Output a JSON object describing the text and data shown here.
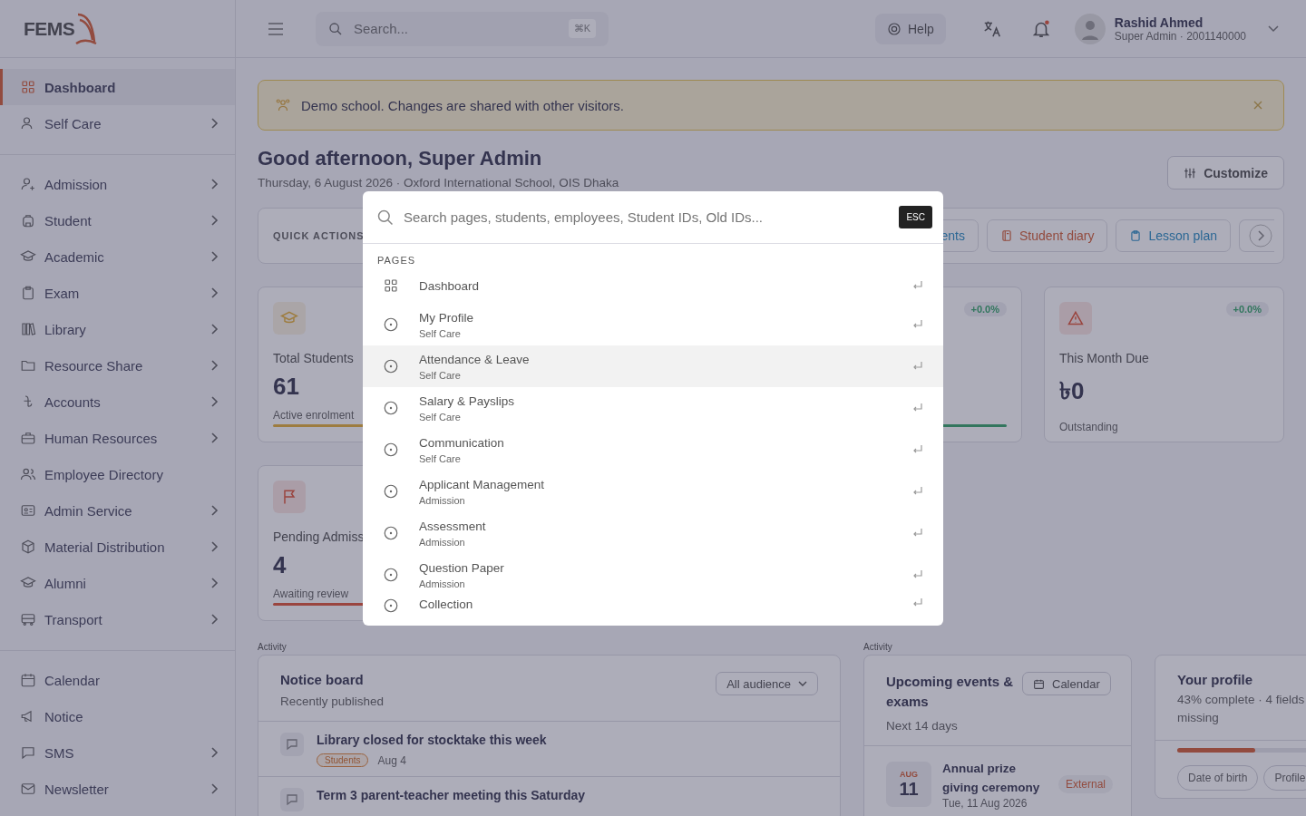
{
  "brand": {
    "name": "FEMS"
  },
  "sidebar": {
    "groups": [
      {
        "items": [
          {
            "label": "Dashboard",
            "selected": true,
            "submenu": false
          },
          {
            "label": "Self Care",
            "selected": false,
            "submenu": true
          }
        ]
      },
      {
        "items": [
          {
            "label": "Admission",
            "selected": false,
            "submenu": true
          },
          {
            "label": "Student",
            "selected": false,
            "submenu": true
          },
          {
            "label": "Academic",
            "selected": false,
            "submenu": true
          },
          {
            "label": "Exam",
            "selected": false,
            "submenu": true
          },
          {
            "label": "Library",
            "selected": false,
            "submenu": true
          },
          {
            "label": "Resource Share",
            "selected": false,
            "submenu": true
          },
          {
            "label": "Accounts",
            "selected": false,
            "submenu": true
          },
          {
            "label": "Human Resources",
            "selected": false,
            "submenu": true
          },
          {
            "label": "Employee Directory",
            "selected": false,
            "submenu": false
          },
          {
            "label": "Admin Service",
            "selected": false,
            "submenu": true
          },
          {
            "label": "Material Distribution",
            "selected": false,
            "submenu": true
          },
          {
            "label": "Alumni",
            "selected": false,
            "submenu": true
          },
          {
            "label": "Transport",
            "selected": false,
            "submenu": true
          }
        ]
      },
      {
        "items": [
          {
            "label": "Calendar",
            "selected": false,
            "submenu": false
          },
          {
            "label": "Notice",
            "selected": false,
            "submenu": false
          },
          {
            "label": "SMS",
            "selected": false,
            "submenu": true
          },
          {
            "label": "Newsletter",
            "selected": false,
            "submenu": true
          }
        ]
      }
    ]
  },
  "topbar": {
    "search": {
      "placeholder": "Search...",
      "shortcut": "⌘K"
    },
    "help": "Help",
    "notifications": {
      "unread": true
    },
    "user": {
      "name": "Rashid Ahmed",
      "role": "Super Admin · 2001140000"
    }
  },
  "banner": {
    "text": "Demo school. Changes are shared with other visitors."
  },
  "greeting": {
    "title": "Good afternoon, Super Admin",
    "subtitle": "Thursday, 6 August 2026 · Oxford International School, OIS Dhaka",
    "action": "Customize"
  },
  "quick_actions": {
    "label": "QUICK ACTIONS",
    "buttons": [
      {
        "kind": "record",
        "label": "ents"
      },
      {
        "kind": "diary",
        "label": "Student diary"
      },
      {
        "kind": "plan",
        "label": "Lesson plan"
      }
    ]
  },
  "stat_cards": [
    {
      "kind": "students",
      "title": "Total Students",
      "value": "61",
      "note": "Active enrolment"
    },
    {
      "kind": "covered",
      "trend": "+0.0%"
    },
    {
      "kind": "due",
      "title": "This Month Due",
      "value": "৳0",
      "note": "Outstanding",
      "trend": "+0.0%"
    }
  ],
  "pending_cards": [
    {
      "kind": "admissions",
      "title": "Pending Admiss",
      "value": "4",
      "note": "Awaiting review"
    }
  ],
  "notice_board": {
    "section": "Activity",
    "title": "Notice board",
    "subtitle": "Recently published",
    "filter": "All audience",
    "items": [
      {
        "title": "Library closed for stocktake this week",
        "tag": "Students",
        "date": "Aug 4"
      },
      {
        "title": "Term 3 parent-teacher meeting this Saturday"
      }
    ]
  },
  "events": {
    "section": "Activity",
    "title": "Upcoming events & exams",
    "subtitle": "Next 14 days",
    "action": "Calendar",
    "items": [
      {
        "month": "AUG",
        "day": "11",
        "title": "Annual prize giving ceremony",
        "date": "Tue, 11 Aug 2026",
        "tag": "External"
      }
    ]
  },
  "profile": {
    "title": "Your profile",
    "subtitle": "43% complete · 4 fields missing",
    "level": 0.43,
    "missing": [
      "Date of birth",
      "Profile"
    ]
  },
  "search_dialog": {
    "placeholder": "Search pages, students, employees, Student IDs, Old IDs...",
    "close_key": "ESC",
    "section": "PAGES",
    "results": [
      {
        "kind": "dashboard",
        "title": "Dashboard",
        "selected": false
      },
      {
        "kind": "page",
        "title": "My Profile",
        "group": "Self Care",
        "selected": false
      },
      {
        "kind": "page",
        "title": "Attendance & Leave",
        "group": "Self Care",
        "selected": true
      },
      {
        "kind": "page",
        "title": "Salary & Payslips",
        "group": "Self Care",
        "selected": false
      },
      {
        "kind": "page",
        "title": "Communication",
        "group": "Self Care",
        "selected": false
      },
      {
        "kind": "page",
        "title": "Applicant Management",
        "group": "Admission",
        "selected": false
      },
      {
        "kind": "page",
        "title": "Assessment",
        "group": "Admission",
        "selected": false
      },
      {
        "kind": "page",
        "title": "Question Paper",
        "group": "Admission",
        "selected": false
      },
      {
        "kind": "page",
        "title": "Collection",
        "selected": false
      }
    ]
  }
}
